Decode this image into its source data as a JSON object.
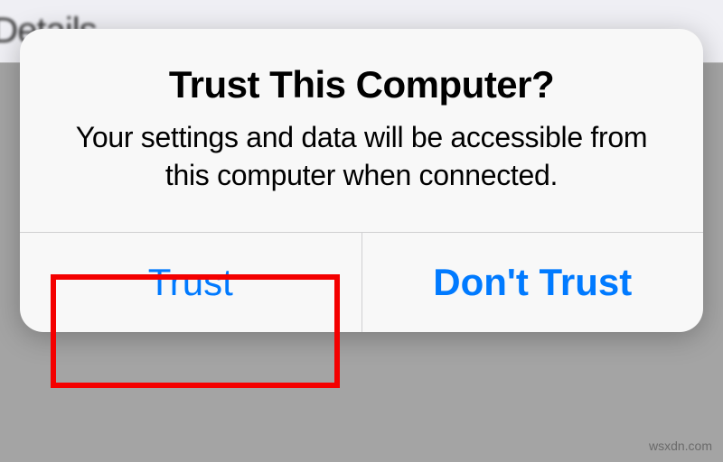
{
  "background": {
    "header_text": "e Details"
  },
  "dialog": {
    "title": "Trust This Computer?",
    "message": "Your settings and data will be accessible from this computer when connected.",
    "buttons": {
      "trust": "Trust",
      "dont_trust": "Don't Trust"
    }
  },
  "watermark": "wsxdn.com"
}
